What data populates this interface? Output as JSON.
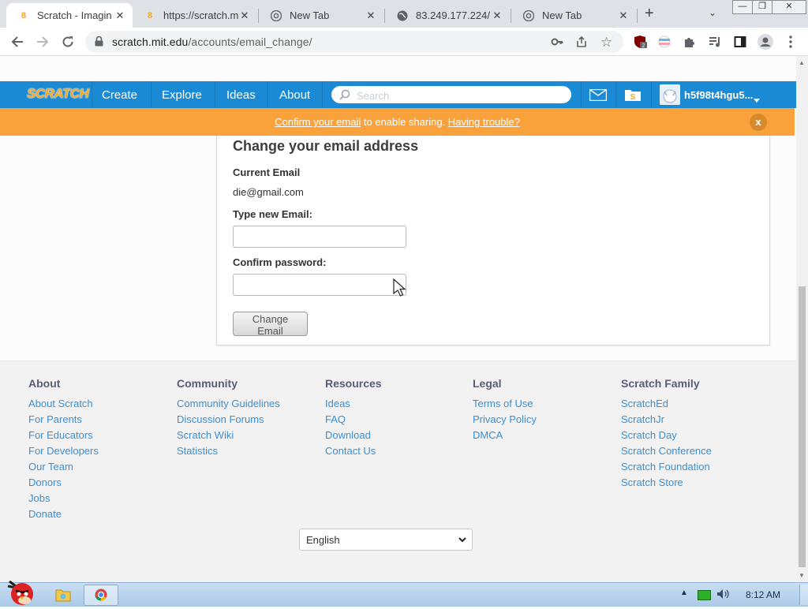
{
  "browser": {
    "tabs": [
      {
        "title": "Scratch - Imagin",
        "favicon": "scratch-cat-icon",
        "active": true
      },
      {
        "title": "https://scratch.m",
        "favicon": "scratch-cat-icon",
        "active": false
      },
      {
        "title": "New Tab",
        "favicon": "chrome-icon",
        "active": false
      },
      {
        "title": "83.249.177.224/",
        "favicon": "globe-icon",
        "active": false
      },
      {
        "title": "New Tab",
        "favicon": "chrome-icon",
        "active": false
      }
    ],
    "url": {
      "domain": "scratch.mit.edu",
      "path": "/accounts/email_change/"
    },
    "extension_badge": "2"
  },
  "nav": {
    "logo": "SCRATCH",
    "links": [
      "Create",
      "Explore",
      "Ideas",
      "About"
    ],
    "search_placeholder": "Search",
    "username": "h5f98t4hgu5..."
  },
  "banner": {
    "confirm_link": "Confirm your email",
    "middle_text": " to enable sharing. ",
    "trouble_link": "Having trouble?",
    "close": "x"
  },
  "form": {
    "title": "Change your email address",
    "current_label": "Current Email",
    "current_value": "die@gmail.com",
    "new_email_label": "Type new Email:",
    "new_email_value": "",
    "password_label": "Confirm password:",
    "password_value": "",
    "submit_label": "Change Email"
  },
  "footer": {
    "columns": [
      {
        "heading": "About",
        "links": [
          "About Scratch",
          "For Parents",
          "For Educators",
          "For Developers",
          "Our Team",
          "Donors",
          "Jobs",
          "Donate"
        ]
      },
      {
        "heading": "Community",
        "links": [
          "Community Guidelines",
          "Discussion Forums",
          "Scratch Wiki",
          "Statistics"
        ]
      },
      {
        "heading": "Resources",
        "links": [
          "Ideas",
          "FAQ",
          "Download",
          "Contact Us"
        ]
      },
      {
        "heading": "Legal",
        "links": [
          "Terms of Use",
          "Privacy Policy",
          "DMCA"
        ]
      },
      {
        "heading": "Scratch Family",
        "links": [
          "ScratchEd",
          "ScratchJr",
          "Scratch Day",
          "Scratch Conference",
          "Scratch Foundation",
          "Scratch Store"
        ]
      }
    ],
    "language": "English"
  },
  "taskbar": {
    "clock": "8:12 AM"
  },
  "colors": {
    "nav_blue": "#1a8ad4",
    "banner_orange": "#f9a23c",
    "link_blue": "#3b8fd4"
  }
}
